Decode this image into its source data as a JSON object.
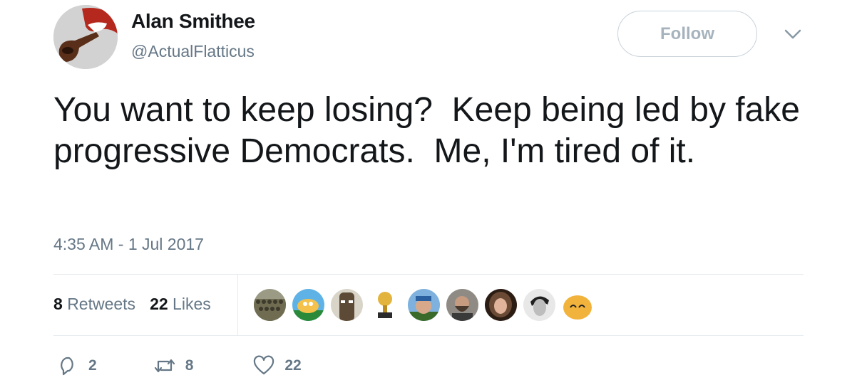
{
  "author": {
    "name": "Alan Smithee",
    "handle": "@ActualFlatticus"
  },
  "follow_label": "Follow",
  "tweet": {
    "text": "You want to keep losing?  Keep being led by fake progressive Democrats.  Me, I'm tired of it.",
    "timestamp": "4:35 AM - 1 Jul 2017"
  },
  "stats": {
    "retweets_count": "8",
    "retweets_label": "Retweets",
    "likes_count": "22",
    "likes_label": "Likes"
  },
  "liker_avatars": [
    {
      "icon": "crowd-avatar-icon",
      "color": "#7c7a5e"
    },
    {
      "icon": "cartoon-fish-avatar-icon",
      "color": "#f3c14d"
    },
    {
      "icon": "moai-statue-avatar-icon",
      "color": "#6b5a44"
    },
    {
      "icon": "trophy-avatar-icon",
      "color": "#e0b13a"
    },
    {
      "icon": "man-outdoors-avatar-icon",
      "color": "#5b8fc7"
    },
    {
      "icon": "bearded-man-avatar-icon",
      "color": "#5c5a57"
    },
    {
      "icon": "woman-avatar-icon",
      "color": "#4a3528"
    },
    {
      "icon": "bw-portrait-avatar-icon",
      "color": "#8a8a8a"
    },
    {
      "icon": "cartoon-face-avatar-icon",
      "color": "#f2b33d"
    }
  ],
  "actions": {
    "reply_count": "2",
    "retweet_count": "8",
    "like_count": "22"
  },
  "colors": {
    "text_primary": "#14171a",
    "text_secondary": "#657786",
    "divider": "#e6ecf0"
  }
}
